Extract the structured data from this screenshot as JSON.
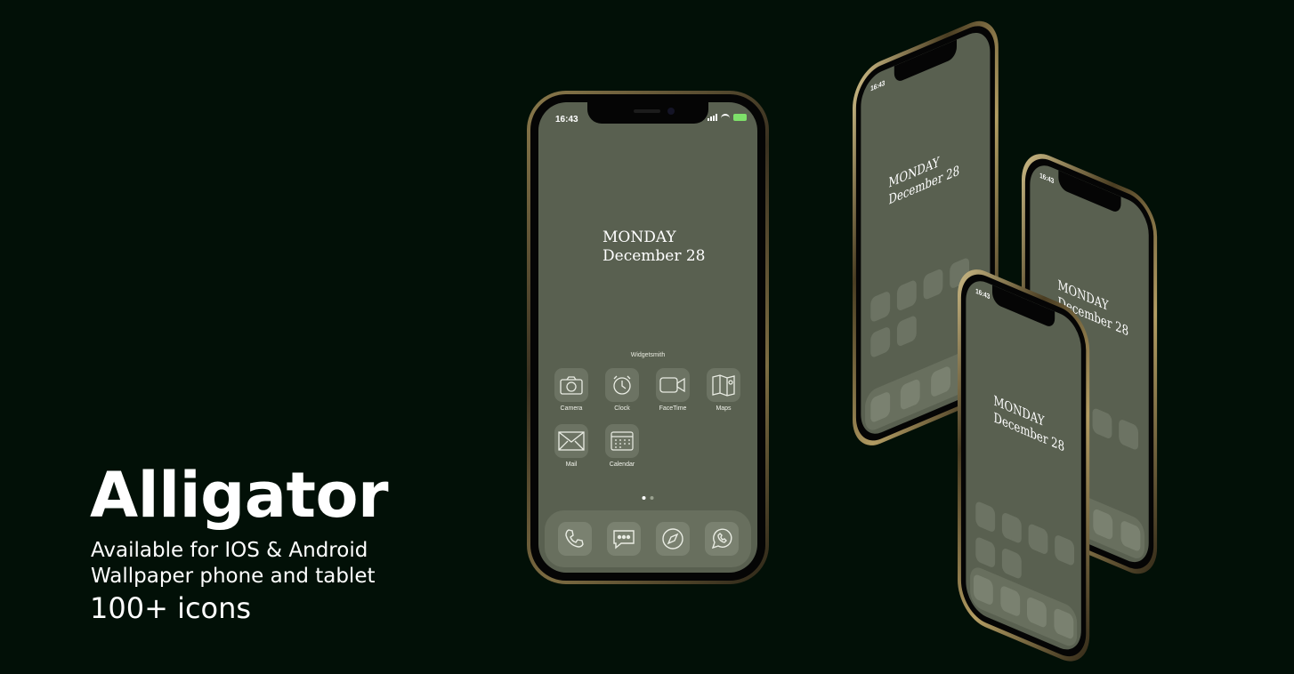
{
  "hero": {
    "title": "Alligator",
    "line1": "Available for IOS & Android",
    "line2": "Wallpaper phone and tablet",
    "line3": "100+ icons"
  },
  "phone": {
    "time": "16:43",
    "date_day": "MONDAY",
    "date_full": "December 28",
    "widget_label": "Widgetsmith",
    "apps": [
      {
        "label": "Camera",
        "icon": "camera-icon"
      },
      {
        "label": "Clock",
        "icon": "clock-icon"
      },
      {
        "label": "FaceTime",
        "icon": "facetime-icon"
      },
      {
        "label": "Maps",
        "icon": "maps-icon"
      },
      {
        "label": "Mail",
        "icon": "mail-icon"
      },
      {
        "label": "Calendar",
        "icon": "calendar-icon"
      }
    ],
    "dock": [
      "phone-icon",
      "messages-icon",
      "safari-icon",
      "whatsapp-icon"
    ],
    "page_indicator": {
      "pages": 2,
      "active": 1
    }
  },
  "iso_phones": {
    "time": "16:43",
    "date_day": "MONDAY",
    "date_full": "December 28"
  },
  "colors": {
    "background": "#021007",
    "screen": "#596050",
    "icon_tile": "#6c7363",
    "gold_frame": "#b39d63"
  }
}
